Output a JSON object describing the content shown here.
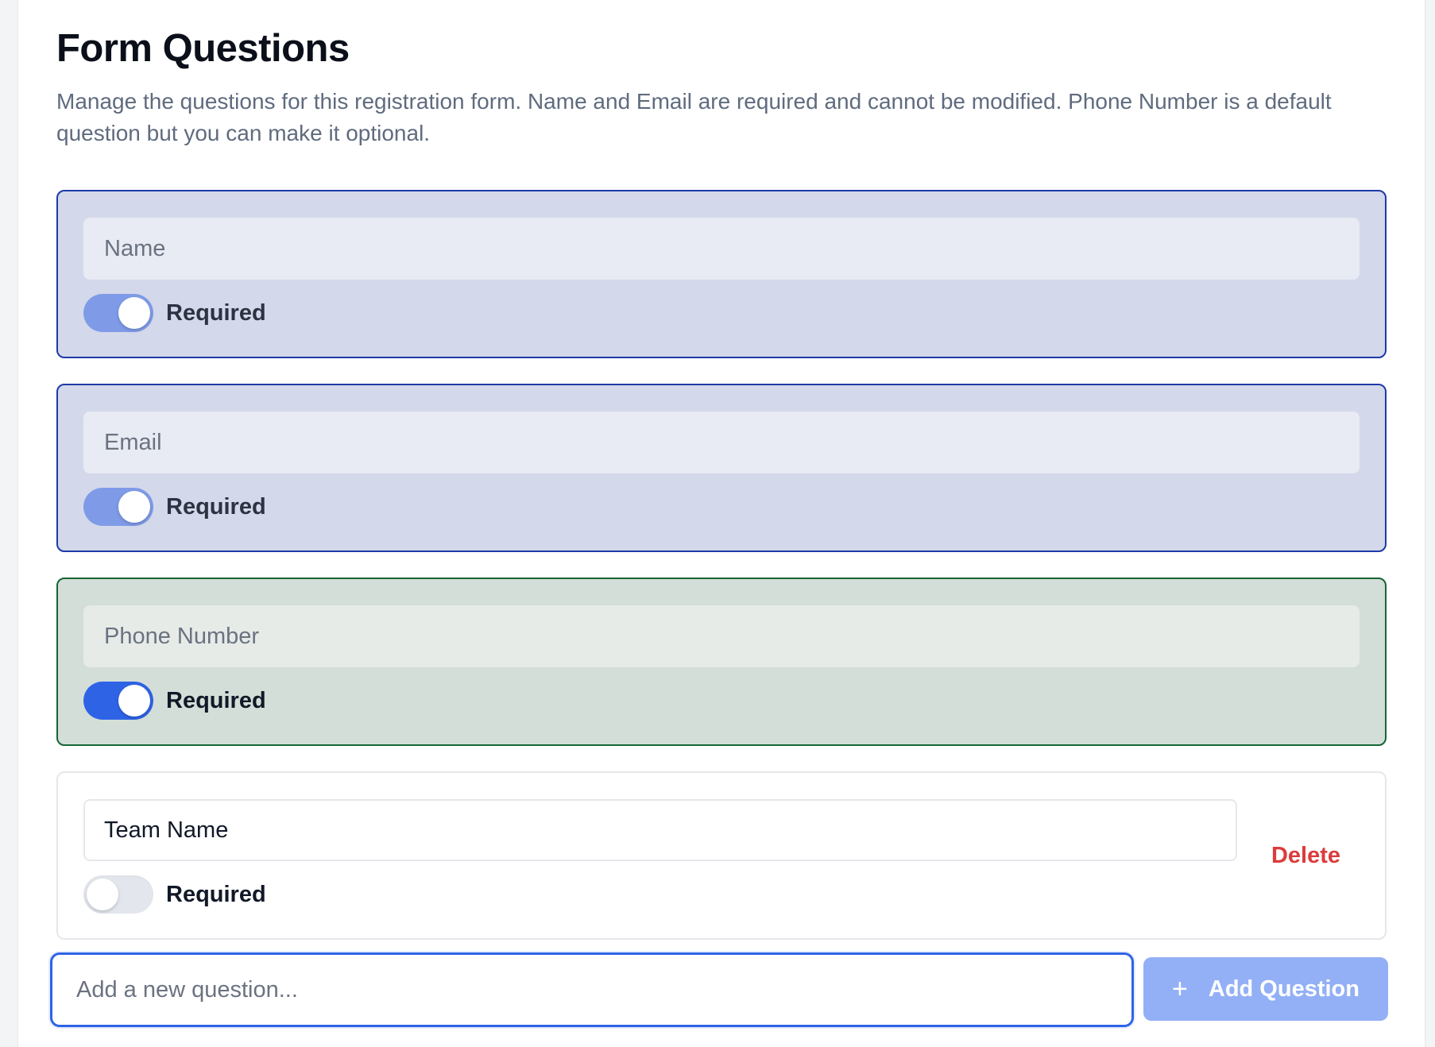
{
  "header": {
    "title": "Form Questions",
    "description": "Manage the questions for this registration form. Name and Email are required and cannot be modified. Phone Number is a default question but you can make it optional."
  },
  "questions": [
    {
      "label": "Name",
      "required_label": "Required",
      "required": true,
      "locked": true
    },
    {
      "label": "Email",
      "required_label": "Required",
      "required": true,
      "locked": true
    },
    {
      "label": "Phone Number",
      "required_label": "Required",
      "required": true,
      "locked": false
    },
    {
      "label": "Team Name",
      "required_label": "Required",
      "required": false,
      "locked": false,
      "delete_label": "Delete"
    }
  ],
  "add_question": {
    "placeholder": "Add a new question...",
    "button_label": "Add Question",
    "button_icon": "plus-icon"
  },
  "colors": {
    "accent": "#2f63e6",
    "locked_border": "#1e3aa8",
    "phone_border": "#166534",
    "delete": "#dc3b3b"
  }
}
